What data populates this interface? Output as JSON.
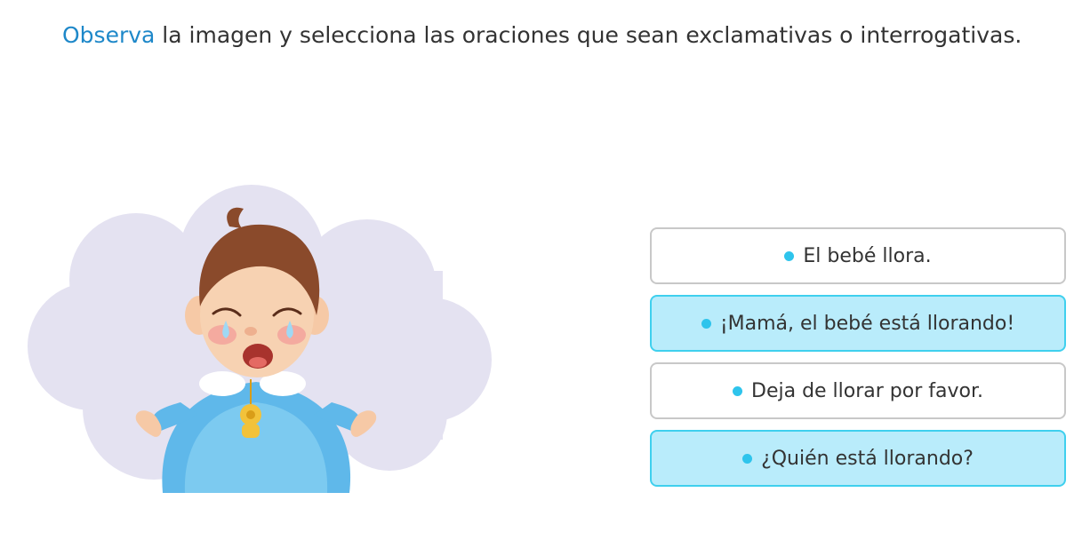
{
  "instruction": {
    "highlight": "Observa",
    "rest": " la imagen y selecciona las oraciones que sean exclamativas o interrogativas."
  },
  "illustration": {
    "icon": "crying-baby-illustration"
  },
  "options": [
    {
      "label": "El bebé llora.",
      "selected": false
    },
    {
      "label": "¡Mamá, el bebé está llorando!",
      "selected": true
    },
    {
      "label": "Deja de llorar por favor.",
      "selected": false
    },
    {
      "label": "¿Quién está llorando?",
      "selected": true
    }
  ],
  "colors": {
    "accent": "#1e88c9",
    "selected_bg": "#b9ecfb",
    "selected_border": "#3fd0ee",
    "bullet": "#2ec4ec",
    "cloud": "#e4e2f1"
  }
}
